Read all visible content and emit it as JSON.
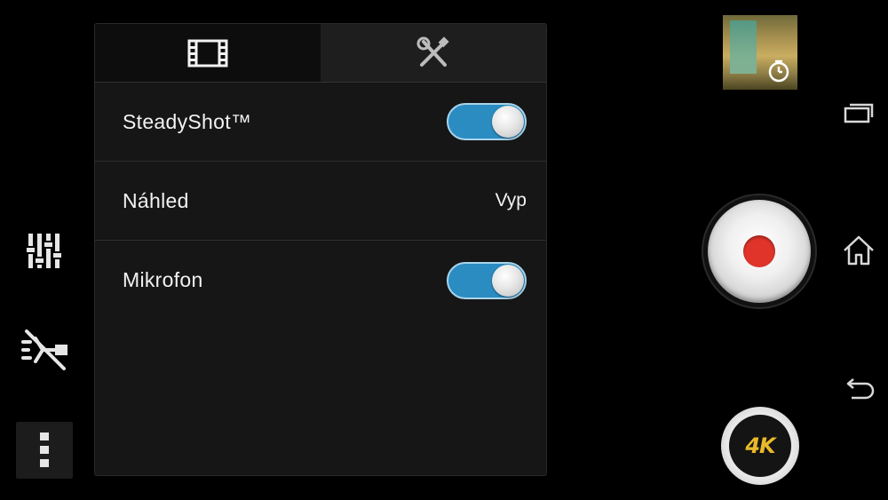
{
  "left_controls": {
    "settings_icon": "sliders-icon",
    "flash_icon": "flash-off-icon",
    "more_icon": "more-vertical-icon"
  },
  "panel": {
    "tabs": [
      {
        "icon": "film-icon",
        "active": true
      },
      {
        "icon": "tools-icon",
        "active": false
      }
    ],
    "rows": [
      {
        "label": "SteadyShot™",
        "type": "toggle",
        "on": true
      },
      {
        "label": "Náhled",
        "type": "value",
        "value": "Vyp"
      },
      {
        "label": "Mikrofon",
        "type": "toggle",
        "on": true
      }
    ]
  },
  "right_controls": {
    "thumbnail_icon": "self-timer-icon",
    "record_icon": "record-icon",
    "mode_label": "4K"
  },
  "nav_bar": {
    "recent_icon": "recent-apps-icon",
    "home_icon": "home-icon",
    "back_icon": "back-icon"
  },
  "colors": {
    "toggle_on": "#2b8cc2",
    "record_red": "#e0342b",
    "badge_gold": "#e8b92a"
  }
}
